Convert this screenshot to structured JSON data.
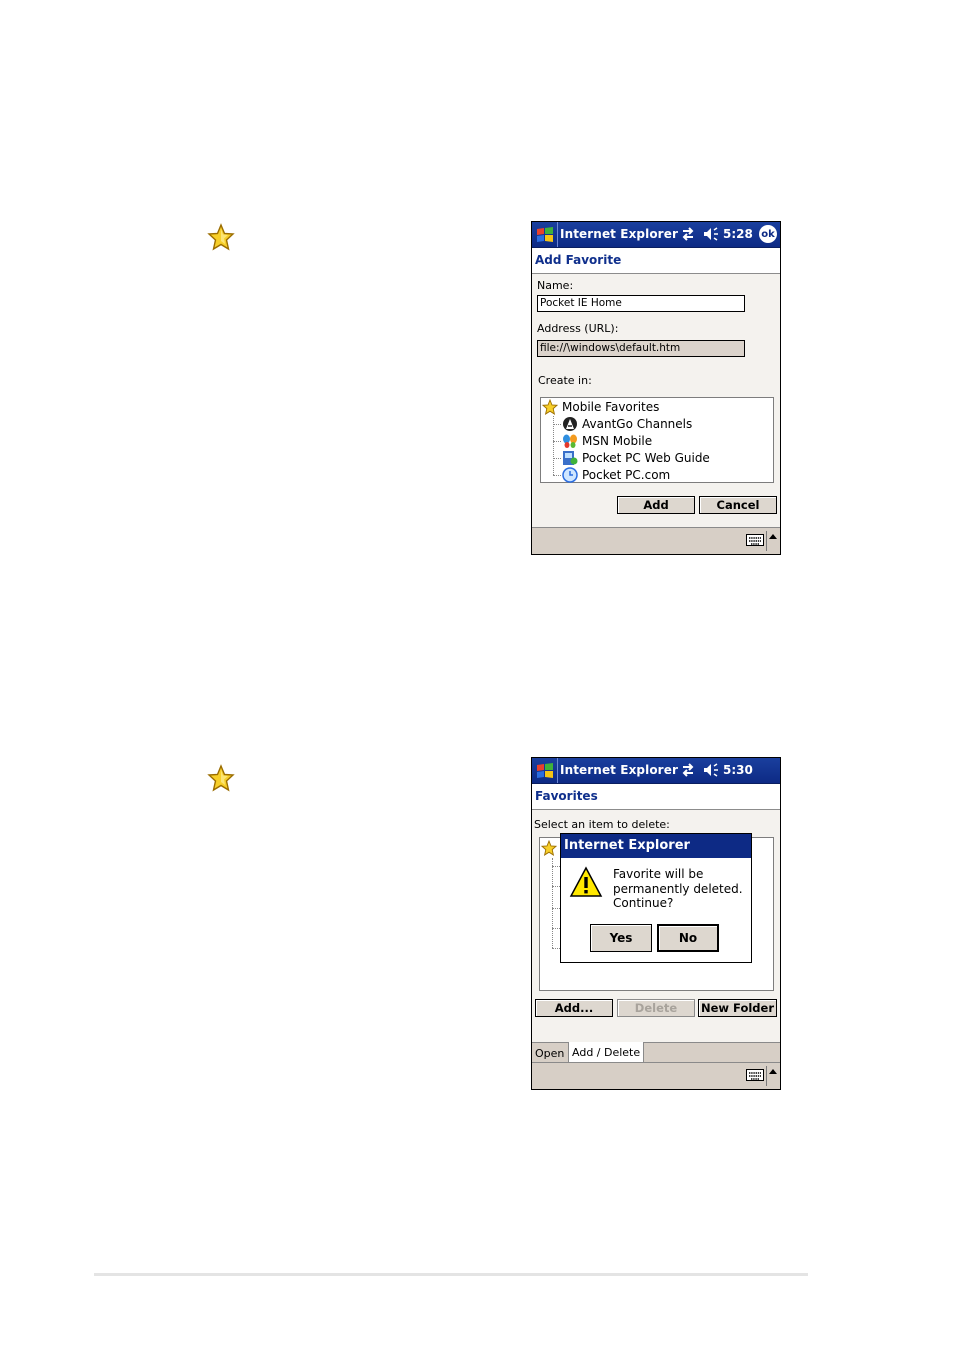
{
  "screen1": {
    "titlebar": {
      "app_title": "Internet Explorer",
      "time": "5:28",
      "ok_label": "ok"
    },
    "page_title": "Add Favorite",
    "name_label": "Name:",
    "name_value": "Pocket IE Home",
    "address_label": "Address (URL):",
    "address_value": "file://\\windows\\default.htm",
    "create_in_label": "Create in:",
    "tree": [
      {
        "label": "Mobile Favorites",
        "icon": "favorites-star-icon"
      },
      {
        "label": "AvantGo Channels",
        "icon": "avantgo-icon"
      },
      {
        "label": "MSN Mobile",
        "icon": "msn-butterfly-icon"
      },
      {
        "label": "Pocket PC Web Guide",
        "icon": "web-guide-icon"
      },
      {
        "label": "Pocket PC.com",
        "icon": "pocketpc-clock-icon"
      }
    ],
    "add_label": "Add",
    "cancel_label": "Cancel"
  },
  "screen2": {
    "titlebar": {
      "app_title": "Internet Explorer",
      "time": "5:30"
    },
    "page_title": "Favorites",
    "instruction": "Select an item to delete:",
    "dialog": {
      "title": "Internet Explorer",
      "message_lines": [
        "Favorite will be",
        "permanently deleted.",
        "Continue?"
      ],
      "yes_label": "Yes",
      "no_label": "No"
    },
    "add_label": "Add...",
    "delete_label": "Delete",
    "new_folder_label": "New Folder",
    "tabs": [
      {
        "label": "Open",
        "active": false
      },
      {
        "label": "Add / Delete",
        "active": true
      }
    ]
  },
  "colors": {
    "title_blue": "#0d2a85",
    "accent_text": "#0f2f8c",
    "bar_beige": "#d7cfc6"
  }
}
